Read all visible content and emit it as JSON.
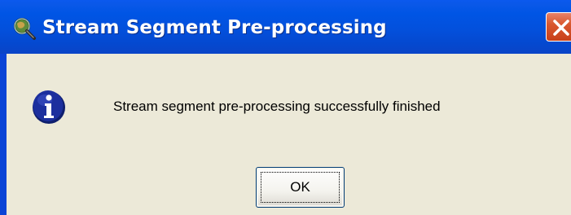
{
  "window": {
    "title": "Stream Segment Pre-processing",
    "title_icon": "magnifier-globe-icon",
    "close_icon": "close-icon"
  },
  "dialog": {
    "icon": "info-icon",
    "message": "Stream segment pre-processing successfully finished",
    "ok_label": "OK"
  },
  "colors": {
    "titlebar": "#0055e5",
    "window_border": "#0a44d6",
    "dialog_background": "#ece9d8",
    "close_button": "#d9582f",
    "info_icon_fill": "#1c2f9e"
  }
}
